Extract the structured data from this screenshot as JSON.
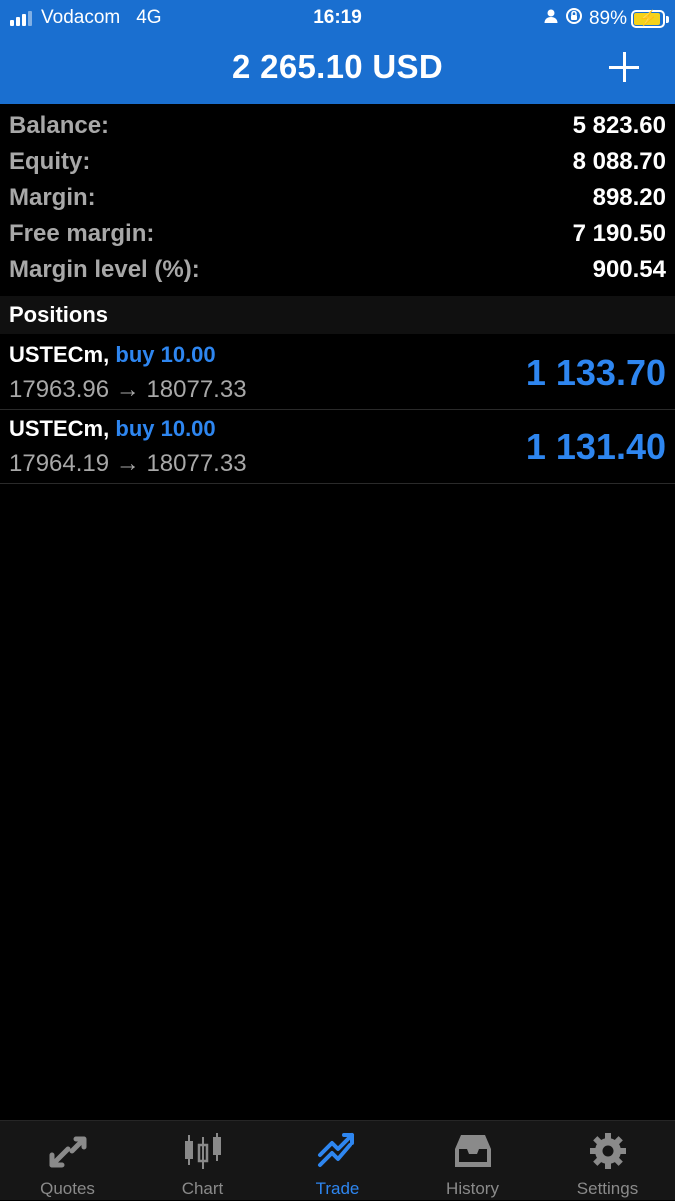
{
  "status_bar": {
    "carrier": "Vodacom",
    "network": "4G",
    "time": "16:19",
    "battery": "89%"
  },
  "header": {
    "title": "2 265.10 USD"
  },
  "summary": [
    {
      "label": "Balance:",
      "value": "5 823.60"
    },
    {
      "label": "Equity:",
      "value": "8 088.70"
    },
    {
      "label": "Margin:",
      "value": "898.20"
    },
    {
      "label": "Free margin:",
      "value": "7 190.50"
    },
    {
      "label": "Margin level (%):",
      "value": "900.54"
    }
  ],
  "positions_section": {
    "title": "Positions"
  },
  "positions": [
    {
      "symbol": "USTECm,",
      "direction": "buy 10.00",
      "prices": "17963.96 → 18077.33",
      "profit": "1 133.70"
    },
    {
      "symbol": "USTECm,",
      "direction": "buy 10.00",
      "prices": "17964.19 → 18077.33",
      "profit": "1 131.40"
    }
  ],
  "tabs": [
    {
      "label": "Quotes",
      "icon": "quotes-icon"
    },
    {
      "label": "Chart",
      "icon": "chart-icon"
    },
    {
      "label": "Trade",
      "icon": "trade-icon",
      "active": true
    },
    {
      "label": "History",
      "icon": "history-icon"
    },
    {
      "label": "Settings",
      "icon": "settings-icon"
    }
  ],
  "colors": {
    "header_bg": "#1a6fd0",
    "accent_blue": "#2e86f0",
    "background": "#000000",
    "label_gray": "#a8a8a8"
  }
}
